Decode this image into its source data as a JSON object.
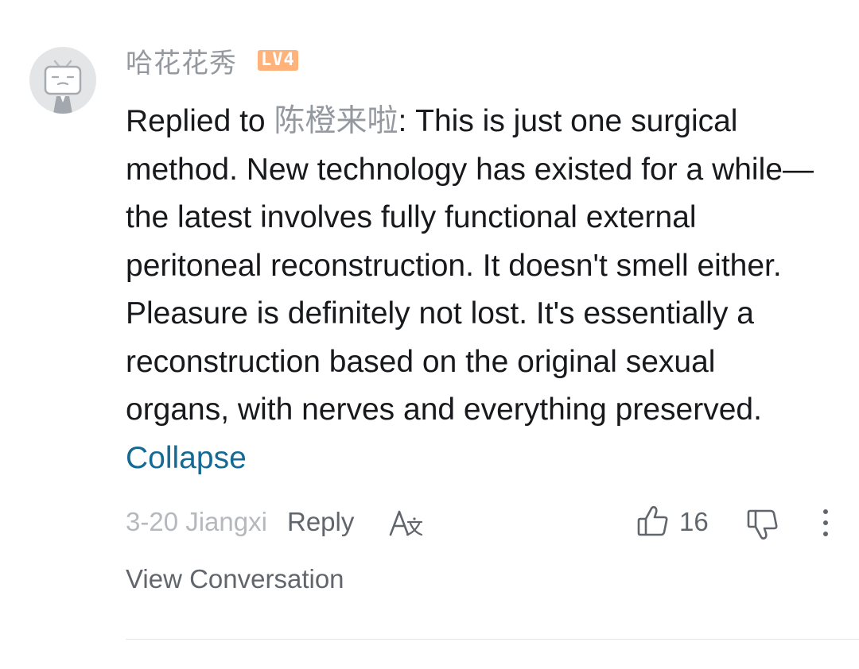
{
  "comment": {
    "username": "哈花花秀",
    "level_badge": "LV4",
    "reply_prefix": "Replied to ",
    "reply_target": "陈橙来啦",
    "body_text": ": This is just one surgical method. New technology has existed for a while—the latest involves fully functional external peritoneal reconstruction. It doesn't smell either. Pleasure is definitely not lost. It's essentially a reconstruction based on the original sexual organs, with nerves and everything preserved. ",
    "collapse_label": "Collapse",
    "date_location": "3-20 Jiangxi",
    "reply_label": "Reply",
    "like_count": "16",
    "view_conversation_label": "View Conversation"
  },
  "icons": {
    "avatar": "default-tv-avatar",
    "translate": "translate-icon",
    "like": "thumbs-up-icon",
    "dislike": "thumbs-down-icon",
    "more": "more-vertical-icon"
  },
  "colors": {
    "text_primary": "#18191c",
    "text_secondary": "#61666d",
    "text_muted": "#9499a0",
    "link": "#156a95",
    "level_badge": "#ffb27a",
    "avatar_bg": "#e3e5e7"
  }
}
